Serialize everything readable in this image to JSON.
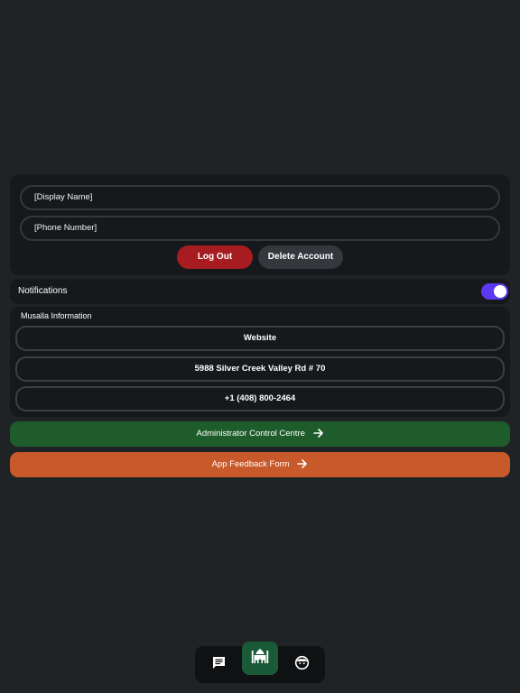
{
  "profile": {
    "display_name_placeholder": "[Display Name]",
    "phone_placeholder": "[Phone Number]",
    "logout_label": "Log Out",
    "delete_label": "Delete Account"
  },
  "notifications": {
    "label": "Notifications",
    "enabled": true
  },
  "musalla": {
    "title": "Musalla Information",
    "website_label": "Website",
    "address_label": "5988 Silver Creek Valley Rd # 70",
    "phone_label": "+1 (408) 800-2464"
  },
  "actions": {
    "admin_label": "Administrator Control Centre",
    "feedback_label": "App Feedback Form"
  },
  "nav": {
    "items": [
      {
        "icon": "chat-icon"
      },
      {
        "icon": "mosque-icon",
        "active": true
      },
      {
        "icon": "profile-icon"
      }
    ]
  },
  "colors": {
    "background": "#1f2326",
    "card": "#16191c",
    "logout": "#a61c20",
    "admin": "#1e5c2c",
    "feedback": "#c7592a",
    "toggle": "#5b39f0",
    "nav_active": "#1a5a39"
  }
}
